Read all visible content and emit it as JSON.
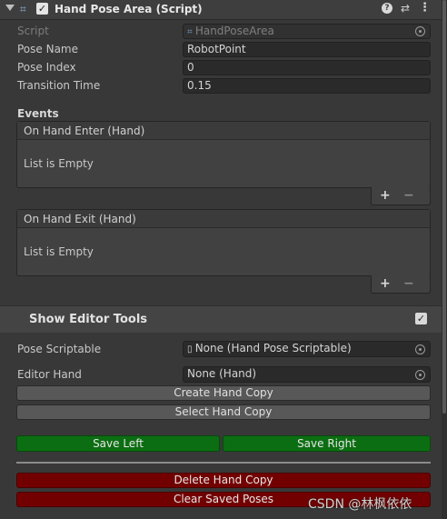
{
  "header": {
    "title": "Hand Pose Area (Script)",
    "enabled": true
  },
  "script_field": {
    "label": "Script",
    "value": "HandPoseArea"
  },
  "fields": {
    "pose_name": {
      "label": "Pose Name",
      "value": "RobotPoint"
    },
    "pose_index": {
      "label": "Pose Index",
      "value": "0"
    },
    "transition_time": {
      "label": "Transition Time",
      "value": "0.15"
    }
  },
  "events": {
    "title": "Events",
    "on_enter": {
      "label": "On Hand Enter (Hand)",
      "empty_text": "List is Empty"
    },
    "on_exit": {
      "label": "On Hand Exit (Hand)",
      "empty_text": "List is Empty"
    },
    "plus": "+",
    "minus": "−"
  },
  "editor_tools": {
    "title": "Show Editor Tools",
    "enabled": true,
    "pose_scriptable": {
      "label": "Pose Scriptable",
      "value": "None (Hand Pose Scriptable)"
    },
    "editor_hand": {
      "label": "Editor Hand",
      "value": "None (Hand)"
    }
  },
  "buttons": {
    "create_hand_copy": "Create Hand Copy",
    "select_hand_copy": "Select Hand Copy",
    "save_left": "Save Left",
    "save_right": "Save Right",
    "delete_hand_copy": "Delete Hand Copy",
    "clear_saved_poses": "Clear Saved Poses"
  },
  "watermark": "CSDN @林枫依依",
  "icons": {
    "fold": "triangle-down",
    "script": "script-icon",
    "help": "help-icon",
    "preset": "preset-icon",
    "menu": "kebab-menu-icon",
    "object_picker": "target-icon"
  },
  "colors": {
    "background": "#383838",
    "field": "#2a2a2a",
    "green_button": "#0c6e12",
    "red_button": "#730000"
  }
}
